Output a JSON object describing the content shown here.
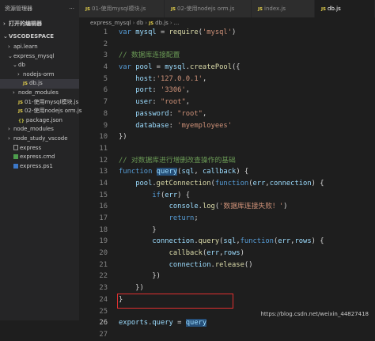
{
  "sidebar": {
    "title": "资源管理器",
    "more_icon": "ellipsis-icon",
    "open_editors": "打开的编辑器",
    "workspace": "VSCODESPACE",
    "tree": [
      {
        "label": "api.learn",
        "indent": 1,
        "type": "folder-collapsed"
      },
      {
        "label": "express_mysql",
        "indent": 1,
        "type": "folder-open"
      },
      {
        "label": "db",
        "indent": 2,
        "type": "folder-open"
      },
      {
        "label": "nodejs-orm",
        "indent": 3,
        "type": "folder-collapsed"
      },
      {
        "label": "db.js",
        "indent": 3,
        "type": "js",
        "selected": true
      },
      {
        "label": "node_modules",
        "indent": 2,
        "type": "folder-collapsed"
      },
      {
        "label": "01-使用mysql模块.js",
        "indent": 2,
        "type": "js"
      },
      {
        "label": "02-使用nodejs orm.js",
        "indent": 2,
        "type": "js"
      },
      {
        "label": "package.json",
        "indent": 2,
        "type": "json"
      },
      {
        "label": "node_modules",
        "indent": 1,
        "type": "folder-collapsed"
      },
      {
        "label": "node_study_vscode",
        "indent": 1,
        "type": "folder-collapsed"
      },
      {
        "label": "express",
        "indent": 1,
        "type": "file"
      },
      {
        "label": "express.cmd",
        "indent": 1,
        "type": "cmd"
      },
      {
        "label": "express.ps1",
        "indent": 1,
        "type": "ps1"
      }
    ]
  },
  "tabs": [
    {
      "label": "01-使用mysql模块.js",
      "active": false
    },
    {
      "label": "02-使用nodejs orm.js",
      "active": false
    },
    {
      "label": "index.js",
      "active": false
    },
    {
      "label": "db.js",
      "active": true
    }
  ],
  "breadcrumb": [
    "express_mysql",
    "db",
    "db.js",
    "..."
  ],
  "editor": {
    "lines": [
      {
        "n": "1",
        "tokens": [
          [
            "kw",
            "var "
          ],
          [
            "var",
            "mysql"
          ],
          [
            "op",
            " = "
          ],
          [
            "fn",
            "require"
          ],
          [
            "op",
            "("
          ],
          [
            "str",
            "'mysql'"
          ],
          [
            "op",
            ")"
          ]
        ]
      },
      {
        "n": "2",
        "tokens": []
      },
      {
        "n": "3",
        "tokens": [
          [
            "com",
            "// 数据库连接配置"
          ]
        ]
      },
      {
        "n": "4",
        "tokens": [
          [
            "kw",
            "var "
          ],
          [
            "var",
            "pool"
          ],
          [
            "op",
            " = "
          ],
          [
            "var",
            "mysql"
          ],
          [
            "op",
            "."
          ],
          [
            "fn",
            "createPool"
          ],
          [
            "op",
            "({"
          ]
        ]
      },
      {
        "n": "5",
        "tokens": [
          [
            "op",
            "    "
          ],
          [
            "var",
            "host"
          ],
          [
            "op",
            ":"
          ],
          [
            "str",
            "'127.0.0.1'"
          ],
          [
            "op",
            ","
          ]
        ]
      },
      {
        "n": "6",
        "tokens": [
          [
            "op",
            "    "
          ],
          [
            "var",
            "port"
          ],
          [
            "op",
            ": "
          ],
          [
            "str",
            "'3306'"
          ],
          [
            "op",
            ","
          ]
        ]
      },
      {
        "n": "7",
        "tokens": [
          [
            "op",
            "    "
          ],
          [
            "var",
            "user"
          ],
          [
            "op",
            ": "
          ],
          [
            "str",
            "\"root\""
          ],
          [
            "op",
            ","
          ]
        ]
      },
      {
        "n": "8",
        "tokens": [
          [
            "op",
            "    "
          ],
          [
            "var",
            "password"
          ],
          [
            "op",
            ": "
          ],
          [
            "str",
            "\"root\""
          ],
          [
            "op",
            ","
          ]
        ]
      },
      {
        "n": "9",
        "tokens": [
          [
            "op",
            "    "
          ],
          [
            "var",
            "database"
          ],
          [
            "op",
            ": "
          ],
          [
            "str",
            "'myemployees'"
          ]
        ]
      },
      {
        "n": "10",
        "tokens": [
          [
            "op",
            "})"
          ]
        ]
      },
      {
        "n": "11",
        "tokens": []
      },
      {
        "n": "12",
        "tokens": [
          [
            "com",
            "// 对数据库进行增删改查操作的基础"
          ]
        ]
      },
      {
        "n": "13",
        "tokens": [
          [
            "kw",
            "function "
          ],
          [
            "hl",
            "query"
          ],
          [
            "op",
            "("
          ],
          [
            "var",
            "sql"
          ],
          [
            "op",
            ", "
          ],
          [
            "var",
            "callback"
          ],
          [
            "op",
            ") {"
          ]
        ]
      },
      {
        "n": "14",
        "tokens": [
          [
            "op",
            "    "
          ],
          [
            "var",
            "pool"
          ],
          [
            "op",
            "."
          ],
          [
            "fn",
            "getConnection"
          ],
          [
            "op",
            "("
          ],
          [
            "kw",
            "function"
          ],
          [
            "op",
            "("
          ],
          [
            "var",
            "err"
          ],
          [
            "op",
            ","
          ],
          [
            "var",
            "connection"
          ],
          [
            "op",
            ") {"
          ]
        ]
      },
      {
        "n": "15",
        "tokens": [
          [
            "op",
            "        "
          ],
          [
            "kw",
            "if"
          ],
          [
            "op",
            "("
          ],
          [
            "var",
            "err"
          ],
          [
            "op",
            ") {"
          ]
        ]
      },
      {
        "n": "16",
        "tokens": [
          [
            "op",
            "            "
          ],
          [
            "var",
            "console"
          ],
          [
            "op",
            "."
          ],
          [
            "fn",
            "log"
          ],
          [
            "op",
            "("
          ],
          [
            "str",
            "'数据库连接失败！'"
          ],
          [
            "op",
            ")"
          ]
        ]
      },
      {
        "n": "17",
        "tokens": [
          [
            "op",
            "            "
          ],
          [
            "kw",
            "return"
          ],
          [
            "op",
            ";"
          ]
        ]
      },
      {
        "n": "18",
        "tokens": [
          [
            "op",
            "        }"
          ]
        ]
      },
      {
        "n": "19",
        "tokens": [
          [
            "op",
            "        "
          ],
          [
            "var",
            "connection"
          ],
          [
            "op",
            "."
          ],
          [
            "fn",
            "query"
          ],
          [
            "op",
            "("
          ],
          [
            "var",
            "sql"
          ],
          [
            "op",
            ","
          ],
          [
            "kw",
            "function"
          ],
          [
            "op",
            "("
          ],
          [
            "var",
            "err"
          ],
          [
            "op",
            ","
          ],
          [
            "var",
            "rows"
          ],
          [
            "op",
            ") {"
          ]
        ]
      },
      {
        "n": "20",
        "tokens": [
          [
            "op",
            "            "
          ],
          [
            "fn",
            "callback"
          ],
          [
            "op",
            "("
          ],
          [
            "var",
            "err"
          ],
          [
            "op",
            ","
          ],
          [
            "var",
            "rows"
          ],
          [
            "op",
            ")"
          ]
        ]
      },
      {
        "n": "21",
        "tokens": [
          [
            "op",
            "            "
          ],
          [
            "var",
            "connection"
          ],
          [
            "op",
            "."
          ],
          [
            "fn",
            "release"
          ],
          [
            "op",
            "()"
          ]
        ]
      },
      {
        "n": "22",
        "tokens": [
          [
            "op",
            "        })"
          ]
        ]
      },
      {
        "n": "23",
        "tokens": [
          [
            "op",
            "    })"
          ]
        ]
      },
      {
        "n": "24",
        "tokens": [
          [
            "op",
            "}"
          ]
        ]
      },
      {
        "n": "25",
        "tokens": []
      },
      {
        "n": "26",
        "tokens": [
          [
            "var",
            "exports"
          ],
          [
            "op",
            "."
          ],
          [
            "var",
            "query"
          ],
          [
            "op",
            " = "
          ],
          [
            "hl",
            "query"
          ]
        ]
      },
      {
        "n": "27",
        "tokens": []
      }
    ]
  },
  "watermark": "https://blog.csdn.net/weixin_44827418",
  "colors": {
    "keyword": "#569cd6",
    "variable": "#9cdcfe",
    "function": "#dcdcaa",
    "string": "#ce9178",
    "comment": "#6a9955",
    "highlight_box": "#e03030",
    "js_badge": "#e8d44d"
  }
}
